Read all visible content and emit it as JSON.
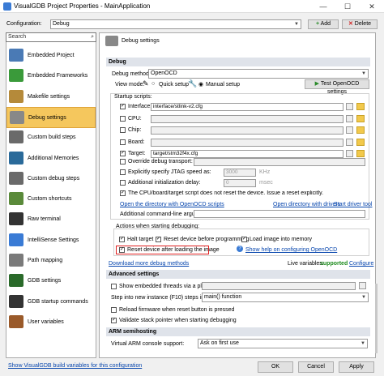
{
  "window": {
    "title": "VisualGDB Project Properties - MainApplication",
    "minimize": "—",
    "maximize": "☐",
    "close": "✕"
  },
  "config": {
    "label": "Configuration:",
    "value": "Debug",
    "add": "Add",
    "delete": "Delete"
  },
  "sidebar": {
    "search_placeholder": "Search",
    "items": [
      {
        "label": "Embedded Project",
        "icon": "chip-icon"
      },
      {
        "label": "Embedded Frameworks",
        "icon": "puzzle-icon"
      },
      {
        "label": "Makefile settings",
        "icon": "pencil-icon"
      },
      {
        "label": "Debug settings",
        "icon": "bug-icon",
        "selected": true
      },
      {
        "label": "Custom build steps",
        "icon": "gear-icon"
      },
      {
        "label": "Additional Memories",
        "icon": "memory-icon"
      },
      {
        "label": "Custom debug steps",
        "icon": "gear-icon"
      },
      {
        "label": "Custom shortcuts",
        "icon": "shortcut-icon"
      },
      {
        "label": "Raw terminal",
        "icon": "terminal-icon"
      },
      {
        "label": "IntelliSense Settings",
        "icon": "intellisense-icon"
      },
      {
        "label": "Path mapping",
        "icon": "mapping-icon"
      },
      {
        "label": "GDB settings",
        "icon": "gdb-icon"
      },
      {
        "label": "GDB startup commands",
        "icon": "terminal-icon"
      },
      {
        "label": "User variables",
        "icon": "variables-icon"
      }
    ]
  },
  "main": {
    "header": "Debug settings",
    "debug_section": "Debug",
    "debug_method_label": "Debug method:",
    "debug_method_value": "OpenOCD",
    "view_mode_label": "View mode:",
    "quick_setup": "Quick setup",
    "manual_setup": "Manual setup",
    "test_button": "Test OpenOCD settings",
    "startup_scripts": "Startup scripts:",
    "scripts": [
      {
        "label": "Interface:",
        "checked": true,
        "value": "interface/stlink-v2.cfg"
      },
      {
        "label": "CPU:",
        "checked": false,
        "value": ""
      },
      {
        "label": "Chip:",
        "checked": false,
        "value": ""
      },
      {
        "label": "Board:",
        "checked": false,
        "value": ""
      },
      {
        "label": "Target:",
        "checked": true,
        "value": "target/stm32f4x.cfg"
      }
    ],
    "override_transport": "Override debug transport:",
    "jtag_speed": "Explicitly specify JTAG speed as:",
    "jtag_value": "3000",
    "jtag_unit": "KHz",
    "init_delay": "Additional initialization delay:",
    "delay_value": "0",
    "delay_unit": "msec",
    "no_reset_note": "The CPU/board/target script does not reset the device. Issue a reset explicitly.",
    "open_scripts_link": "Open the directory with OpenOCD scripts",
    "open_drivers_link": "Open directory with drivers",
    "driver_tool_link": "Start driver tool",
    "cmdline_label": "Additional command-line arguments:",
    "actions_label": "Actions when starting debugging:",
    "halt_target": "Halt target",
    "reset_before": "Reset device before programming",
    "load_image": "Load image into memory",
    "reset_after": "Reset device after loading the image",
    "help_link": "Show help on configuring OpenOCD",
    "download_link": "Download more debug methods",
    "live_vars_label": "Live variables:",
    "live_vars_value": "supported",
    "live_vars_link": "Configure",
    "advanced_section": "Advanced settings",
    "show_threads": "Show embedded threads via a plugin:",
    "step_into_label": "Step into new instance (F10) steps in:",
    "step_into_value": "main() function",
    "reload_firmware": "Reload firmware when reset button is pressed",
    "validate_stack": "Validate stack pointer when starting debugging",
    "arm_section": "ARM semihosting",
    "arm_console_label": "Virtual ARM console support:",
    "arm_console_value": "Ask on first use"
  },
  "footer": {
    "vars_link": "Show VisualGDB build variables for this configuration",
    "ok": "OK",
    "cancel": "Cancel",
    "apply": "Apply"
  },
  "colors": {
    "selected_item": "#f5c75d",
    "section_bg": "#dfe3ea",
    "highlight_box": "#e02020",
    "link": "#0645ad",
    "supported": "#1a8a1a"
  }
}
